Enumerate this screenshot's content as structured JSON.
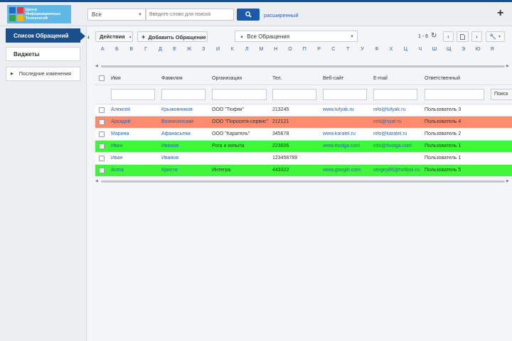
{
  "logo": {
    "line1": "Центр",
    "line2": "Информационных",
    "line3": "Технологий"
  },
  "header": {
    "scope_value": "Все",
    "search_placeholder": "Введите слово для поиска",
    "advanced_label": "расширенный",
    "add_label": "+"
  },
  "sidebar": {
    "items": [
      {
        "label": "Список Обращений"
      },
      {
        "label": "Виджеты"
      }
    ],
    "recent_label": "Последние изменения"
  },
  "toolbar": {
    "actions_label": "Действия",
    "add_label": "Добавить Обращение",
    "filter_value": "Все Обращения",
    "range": "1 - 6"
  },
  "alphabet": [
    "А",
    "Б",
    "В",
    "Г",
    "Д",
    "Е",
    "Ж",
    "З",
    "И",
    "К",
    "Л",
    "М",
    "Н",
    "О",
    "П",
    "Р",
    "С",
    "Т",
    "У",
    "Ф",
    "Х",
    "Ц",
    "Ч",
    "Ш",
    "Щ",
    "Э",
    "Ю",
    "Я"
  ],
  "table": {
    "columns": [
      "Имя",
      "Фамилия",
      "Организация",
      "Тел.",
      "Веб-сайт",
      "E-mail",
      "Ответственный"
    ],
    "find_label": "Поиск",
    "rows": [
      {
        "name": "Алексей",
        "surname": "Крыжовников",
        "org": "ООО \"Тюфяк\"",
        "phone": "213245",
        "site": "www.tufyak.ru",
        "email": "info@tufyak.ru",
        "owner": "Пользователь 3",
        "bg": "#ffffff"
      },
      {
        "name": "Аркадий",
        "surname": "Вознесенский",
        "org": "ООО \"Поросята-сервис\"",
        "phone": "212121",
        "site": "",
        "email": "info@nyaf.ru",
        "owner": "Пользователь 4",
        "bg": "#fd8c6e"
      },
      {
        "name": "Марина",
        "surname": "Афанасьева",
        "org": "ООО \"Каратель\"",
        "phone": "345678",
        "site": "www.karatel.ru",
        "email": "info@karatel.ru",
        "owner": "Пользователь 2",
        "bg": "#ffffff"
      },
      {
        "name": "Иван",
        "surname": "Иванов",
        "org": "Рога и копыта",
        "phone": "223606",
        "site": "www.itvolga.com",
        "email": "info@itvolga.com",
        "owner": "Пользователь 1",
        "bg": "#3ff63a"
      },
      {
        "name": "Иван",
        "surname": "Иванов",
        "org": "",
        "phone": "123456789",
        "site": "",
        "email": "",
        "owner": "Пользователь 1",
        "bg": "#ffffff"
      },
      {
        "name": "Агата",
        "surname": "Кристи",
        "org": "Интегра",
        "phone": "443322",
        "site": "www.google.com",
        "email": "sergey86@hotbox.ru",
        "owner": "Пользователь 5",
        "bg": "#3ff63a"
      }
    ]
  },
  "colors": {
    "brand": "#1a4f8c",
    "link": "#2a63b4",
    "highlight_orange": "#fd8c6e",
    "highlight_green": "#3ff63a"
  }
}
